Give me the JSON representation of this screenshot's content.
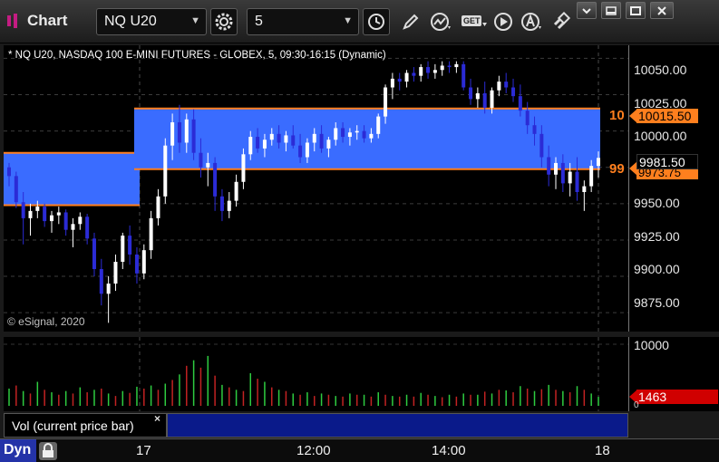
{
  "toolbar": {
    "title": "Chart",
    "symbol": "NQ U20",
    "interval": "5",
    "icons": [
      "chart-logo-icon",
      "gear-icon",
      "clock-icon",
      "pencil-icon",
      "line-chart-icon",
      "get-icon",
      "play-icon",
      "alert-icon",
      "link-icon",
      "restore-icon",
      "minimize-icon",
      "maximize-icon",
      "close-icon"
    ],
    "get_label": "GET"
  },
  "price_pane": {
    "title": "* NQ U20, NASDAQ 100 E-MINI FUTURES - GLOBEX, 5, 09:30-16:15 (Dynamic)",
    "copyright": "© eSignal, 2020",
    "axis_labels": [
      "10050.00",
      "10025.00",
      "10000.00",
      "9975.00",
      "9950.00",
      "9925.00",
      "9900.00",
      "9875.00"
    ],
    "upper_tag": "10015.50",
    "upper_tag_prefix": "10",
    "last_tag": "9981.50",
    "lower_tag": "9973.75",
    "lower_tag_prefix": "99",
    "colors": {
      "band": "#3a6cff",
      "band_line": "#ff7f1e",
      "tag_orange": "#ff7f1e",
      "candle_down": "#2b2bd6",
      "candle_up": "#ffffff"
    }
  },
  "volume_pane": {
    "axis_top": "10000",
    "axis_zero": "0",
    "last_volume": "1463",
    "legend": "Vol (current price bar)",
    "close_label": "×",
    "colors": {
      "vol_up": "#2ecc40",
      "vol_down": "#c22222",
      "last_tag": "#d00000"
    }
  },
  "time_axis": {
    "mode": "Dyn",
    "labels": [
      "17",
      "12:00",
      "14:00",
      "18"
    ]
  },
  "chart_data": {
    "type": "candlestick",
    "ylim": [
      9862,
      10059
    ],
    "bands": [
      {
        "top": 9985,
        "bottom": 9949
      },
      {
        "top": 10015.5,
        "bottom": 9973.75
      }
    ],
    "candles": [
      [
        9975,
        9978,
        9962,
        9969
      ],
      [
        9969,
        9972,
        9947,
        9951
      ],
      [
        9951,
        9958,
        9922,
        9940
      ],
      [
        9940,
        9950,
        9928,
        9945
      ],
      [
        9945,
        9952,
        9940,
        9948
      ],
      [
        9948,
        9950,
        9934,
        9938
      ],
      [
        9938,
        9945,
        9930,
        9942
      ],
      [
        9942,
        9948,
        9936,
        9944
      ],
      [
        9944,
        9946,
        9928,
        9932
      ],
      [
        9932,
        9940,
        9920,
        9936
      ],
      [
        9936,
        9944,
        9932,
        9941
      ],
      [
        9941,
        9943,
        9922,
        9926
      ],
      [
        9926,
        9930,
        9900,
        9905
      ],
      [
        9905,
        9912,
        9880,
        9888
      ],
      [
        9888,
        9900,
        9868,
        9895
      ],
      [
        9895,
        9915,
        9890,
        9910
      ],
      [
        9910,
        9930,
        9905,
        9928
      ],
      [
        9928,
        9935,
        9908,
        9915
      ],
      [
        9915,
        9920,
        9895,
        9902
      ],
      [
        9902,
        9922,
        9898,
        9918
      ],
      [
        9918,
        9945,
        9912,
        9940
      ],
      [
        9940,
        9960,
        9935,
        9955
      ],
      [
        9955,
        9995,
        9950,
        9990
      ],
      [
        9990,
        10012,
        9980,
        10006
      ],
      [
        10006,
        10018,
        9985,
        9992
      ],
      [
        9992,
        10012,
        9985,
        10008
      ],
      [
        10008,
        10015,
        9980,
        9985
      ],
      [
        9985,
        9995,
        9968,
        9975
      ],
      [
        9975,
        9985,
        9962,
        9978
      ],
      [
        9978,
        9982,
        9945,
        9955
      ],
      [
        9955,
        9960,
        9938,
        9945
      ],
      [
        9945,
        9958,
        9940,
        9952
      ],
      [
        9952,
        9970,
        9948,
        9965
      ],
      [
        9965,
        9988,
        9960,
        9984
      ],
      [
        9984,
        10000,
        9980,
        9996
      ],
      [
        9996,
        10002,
        9985,
        9988
      ],
      [
        9988,
        9998,
        9982,
        9994
      ],
      [
        9994,
        10002,
        9990,
        9998
      ],
      [
        9998,
        10004,
        9988,
        9992
      ],
      [
        9992,
        10000,
        9986,
        9997
      ],
      [
        9997,
        10004,
        9988,
        9990
      ],
      [
        9990,
        9998,
        9978,
        9982
      ],
      [
        9982,
        9995,
        9978,
        9992
      ],
      [
        9992,
        10002,
        9986,
        9998
      ],
      [
        9998,
        10004,
        9985,
        9988
      ],
      [
        9988,
        9996,
        9982,
        9994
      ],
      [
        9994,
        10006,
        9990,
        10002
      ],
      [
        10002,
        10006,
        9992,
        9996
      ],
      [
        9996,
        10002,
        9990,
        9999
      ],
      [
        9999,
        10004,
        9994,
        10000
      ],
      [
        10000,
        10004,
        9992,
        9995
      ],
      [
        9995,
        10002,
        9992,
        9998
      ],
      [
        9998,
        10012,
        9995,
        10010
      ],
      [
        10010,
        10032,
        10005,
        10030
      ],
      [
        10030,
        10040,
        10022,
        10036
      ],
      [
        10036,
        10040,
        10028,
        10034
      ],
      [
        10034,
        10042,
        10030,
        10040
      ],
      [
        10040,
        10044,
        10034,
        10038
      ],
      [
        10038,
        10046,
        10034,
        10044
      ],
      [
        10044,
        10048,
        10036,
        10040
      ],
      [
        10040,
        10046,
        10036,
        10042
      ],
      [
        10042,
        10048,
        10038,
        10045
      ],
      [
        10045,
        10048,
        10040,
        10044
      ],
      [
        10044,
        10048,
        10040,
        10046
      ],
      [
        10046,
        10048,
        10028,
        10030
      ],
      [
        10030,
        10036,
        10018,
        10022
      ],
      [
        10022,
        10030,
        10016,
        10026
      ],
      [
        10026,
        10034,
        10012,
        10016
      ],
      [
        10016,
        10030,
        10012,
        10028
      ],
      [
        10028,
        10038,
        10024,
        10034
      ],
      [
        10034,
        10040,
        10026,
        10030
      ],
      [
        10030,
        10036,
        10020,
        10024
      ],
      [
        10024,
        10032,
        10010,
        10014
      ],
      [
        10014,
        10020,
        9998,
        10004
      ],
      [
        10004,
        10010,
        9990,
        9998
      ],
      [
        9998,
        10004,
        9975,
        9982
      ],
      [
        9982,
        9990,
        9962,
        9970
      ],
      [
        9970,
        9982,
        9960,
        9978
      ],
      [
        9978,
        9984,
        9958,
        9964
      ],
      [
        9964,
        9978,
        9955,
        9972
      ],
      [
        9972,
        9982,
        9952,
        9958
      ],
      [
        9958,
        9966,
        9945,
        9962
      ],
      [
        9962,
        9980,
        9958,
        9976
      ],
      [
        9976,
        9986,
        9968,
        9981.5
      ]
    ],
    "volumes": [
      [
        "u",
        2800
      ],
      [
        "d",
        3300
      ],
      [
        "u",
        2400
      ],
      [
        "d",
        2000
      ],
      [
        "u",
        3900
      ],
      [
        "d",
        2600
      ],
      [
        "u",
        2200
      ],
      [
        "d",
        1800
      ],
      [
        "u",
        2400
      ],
      [
        "d",
        2000
      ],
      [
        "u",
        3000
      ],
      [
        "d",
        2200
      ],
      [
        "u",
        2600
      ],
      [
        "d",
        2800
      ],
      [
        "u",
        2000
      ],
      [
        "d",
        1600
      ],
      [
        "u",
        2400
      ],
      [
        "d",
        2100
      ],
      [
        "u",
        3100
      ],
      [
        "d",
        2800
      ],
      [
        "u",
        3300
      ],
      [
        "d",
        2600
      ],
      [
        "u",
        3600
      ],
      [
        "d",
        4200
      ],
      [
        "u",
        5100
      ],
      [
        "d",
        6500
      ],
      [
        "u",
        7400
      ],
      [
        "d",
        6200
      ],
      [
        "u",
        8100
      ],
      [
        "d",
        4900
      ],
      [
        "u",
        3400
      ],
      [
        "d",
        3000
      ],
      [
        "u",
        2600
      ],
      [
        "d",
        2400
      ],
      [
        "u",
        5300
      ],
      [
        "d",
        4400
      ],
      [
        "u",
        3900
      ],
      [
        "d",
        3000
      ],
      [
        "u",
        2600
      ],
      [
        "d",
        2400
      ],
      [
        "u",
        2000
      ],
      [
        "d",
        1800
      ],
      [
        "u",
        2200
      ],
      [
        "d",
        1600
      ],
      [
        "u",
        2000
      ],
      [
        "d",
        1800
      ],
      [
        "u",
        1600
      ],
      [
        "d",
        1500
      ],
      [
        "u",
        2000
      ],
      [
        "d",
        1800
      ],
      [
        "u",
        1800
      ],
      [
        "d",
        1500
      ],
      [
        "u",
        2200
      ],
      [
        "d",
        1800
      ],
      [
        "u",
        1600
      ],
      [
        "d",
        1500
      ],
      [
        "u",
        1800
      ],
      [
        "d",
        1500
      ],
      [
        "u",
        2100
      ],
      [
        "d",
        1800
      ],
      [
        "u",
        1600
      ],
      [
        "d",
        1400
      ],
      [
        "u",
        1800
      ],
      [
        "d",
        1500
      ],
      [
        "u",
        2000
      ],
      [
        "d",
        1800
      ],
      [
        "u",
        1800
      ],
      [
        "d",
        2300
      ],
      [
        "u",
        2000
      ],
      [
        "d",
        2600
      ],
      [
        "u",
        2500
      ],
      [
        "d",
        2200
      ],
      [
        "u",
        3200
      ],
      [
        "d",
        2800
      ],
      [
        "u",
        2400
      ],
      [
        "d",
        2700
      ],
      [
        "u",
        3400
      ],
      [
        "d",
        2600
      ],
      [
        "u",
        2400
      ],
      [
        "d",
        2200
      ],
      [
        "u",
        3200
      ],
      [
        "d",
        2600
      ],
      [
        "u",
        2000
      ],
      [
        "u",
        1463
      ]
    ],
    "vol_ylim": [
      0,
      10000
    ]
  }
}
